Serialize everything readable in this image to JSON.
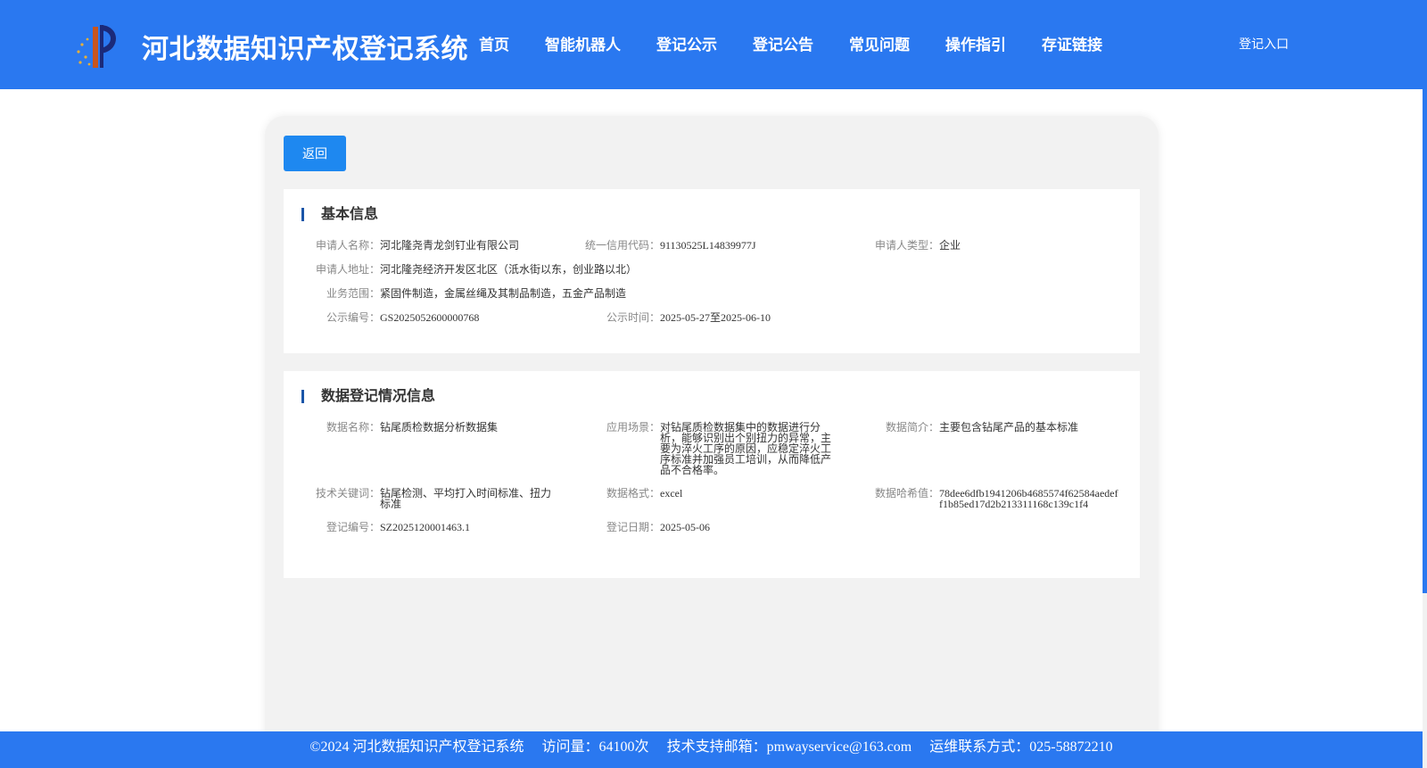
{
  "header": {
    "title": "河北数据知识产权登记系统",
    "nav": [
      "首页",
      "智能机器人",
      "登记公示",
      "登记公告",
      "常见问题",
      "操作指引",
      "存证链接"
    ],
    "login": "登记入口"
  },
  "back_label": "返回",
  "basic_info": {
    "title": "基本信息",
    "applicant_name_label": "申请人名称：",
    "applicant_name": "河北隆尧青龙剑钉业有限公司",
    "credit_code_label": "统一信用代码：",
    "credit_code": "91130525L14839977J",
    "applicant_type_label": "申请人类型：",
    "applicant_type": "企业",
    "address_label": "申请人地址：",
    "address": "河北隆尧经济开发区北区（汦水街以东，创业路以北）",
    "scope_label": "业务范围：",
    "scope": "紧固件制造，金属丝绳及其制品制造，五金产品制造",
    "notice_no_label": "公示编号：",
    "notice_no": "GS2025052600000768",
    "notice_time_label": "公示时间：",
    "notice_time": "2025-05-27至2025-06-10"
  },
  "data_info": {
    "title": "数据登记情况信息",
    "data_name_label": "数据名称：",
    "data_name": "钻尾质检数据分析数据集",
    "scenario_label": "应用场景：",
    "scenario": "对钻尾质检数据集中的数据进行分析，能够识别出个别扭力的异常，主要为淬火工序的原因，应稳定淬火工序标准并加强员工培训，从而降低产品不合格率。",
    "summary_label": "数据简介：",
    "summary": "主要包含钻尾产品的基本标准",
    "keywords_label": "技术关键词：",
    "keywords": "钻尾检测、平均打入时间标准、扭力标准",
    "format_label": "数据格式：",
    "format": "excel",
    "hash_label": "数据哈希值：",
    "hash": "78dee6dfb1941206b4685574f62584aedeff1b85ed17d2b213311168c139c1f4",
    "reg_no_label": "登记编号：",
    "reg_no": "SZ2025120001463.1",
    "reg_date_label": "登记日期：",
    "reg_date": "2025-05-06"
  },
  "footer": {
    "copyright": "©2024 河北数据知识产权登记系统",
    "visits": "访问量：64100次",
    "email": "技术支持邮箱：pmwayservice@163.com",
    "contact": "运维联系方式：025-58872210"
  },
  "colors": {
    "primary": "#2a78f0",
    "button": "#1e88f0",
    "section_bar": "#1a55a8"
  }
}
